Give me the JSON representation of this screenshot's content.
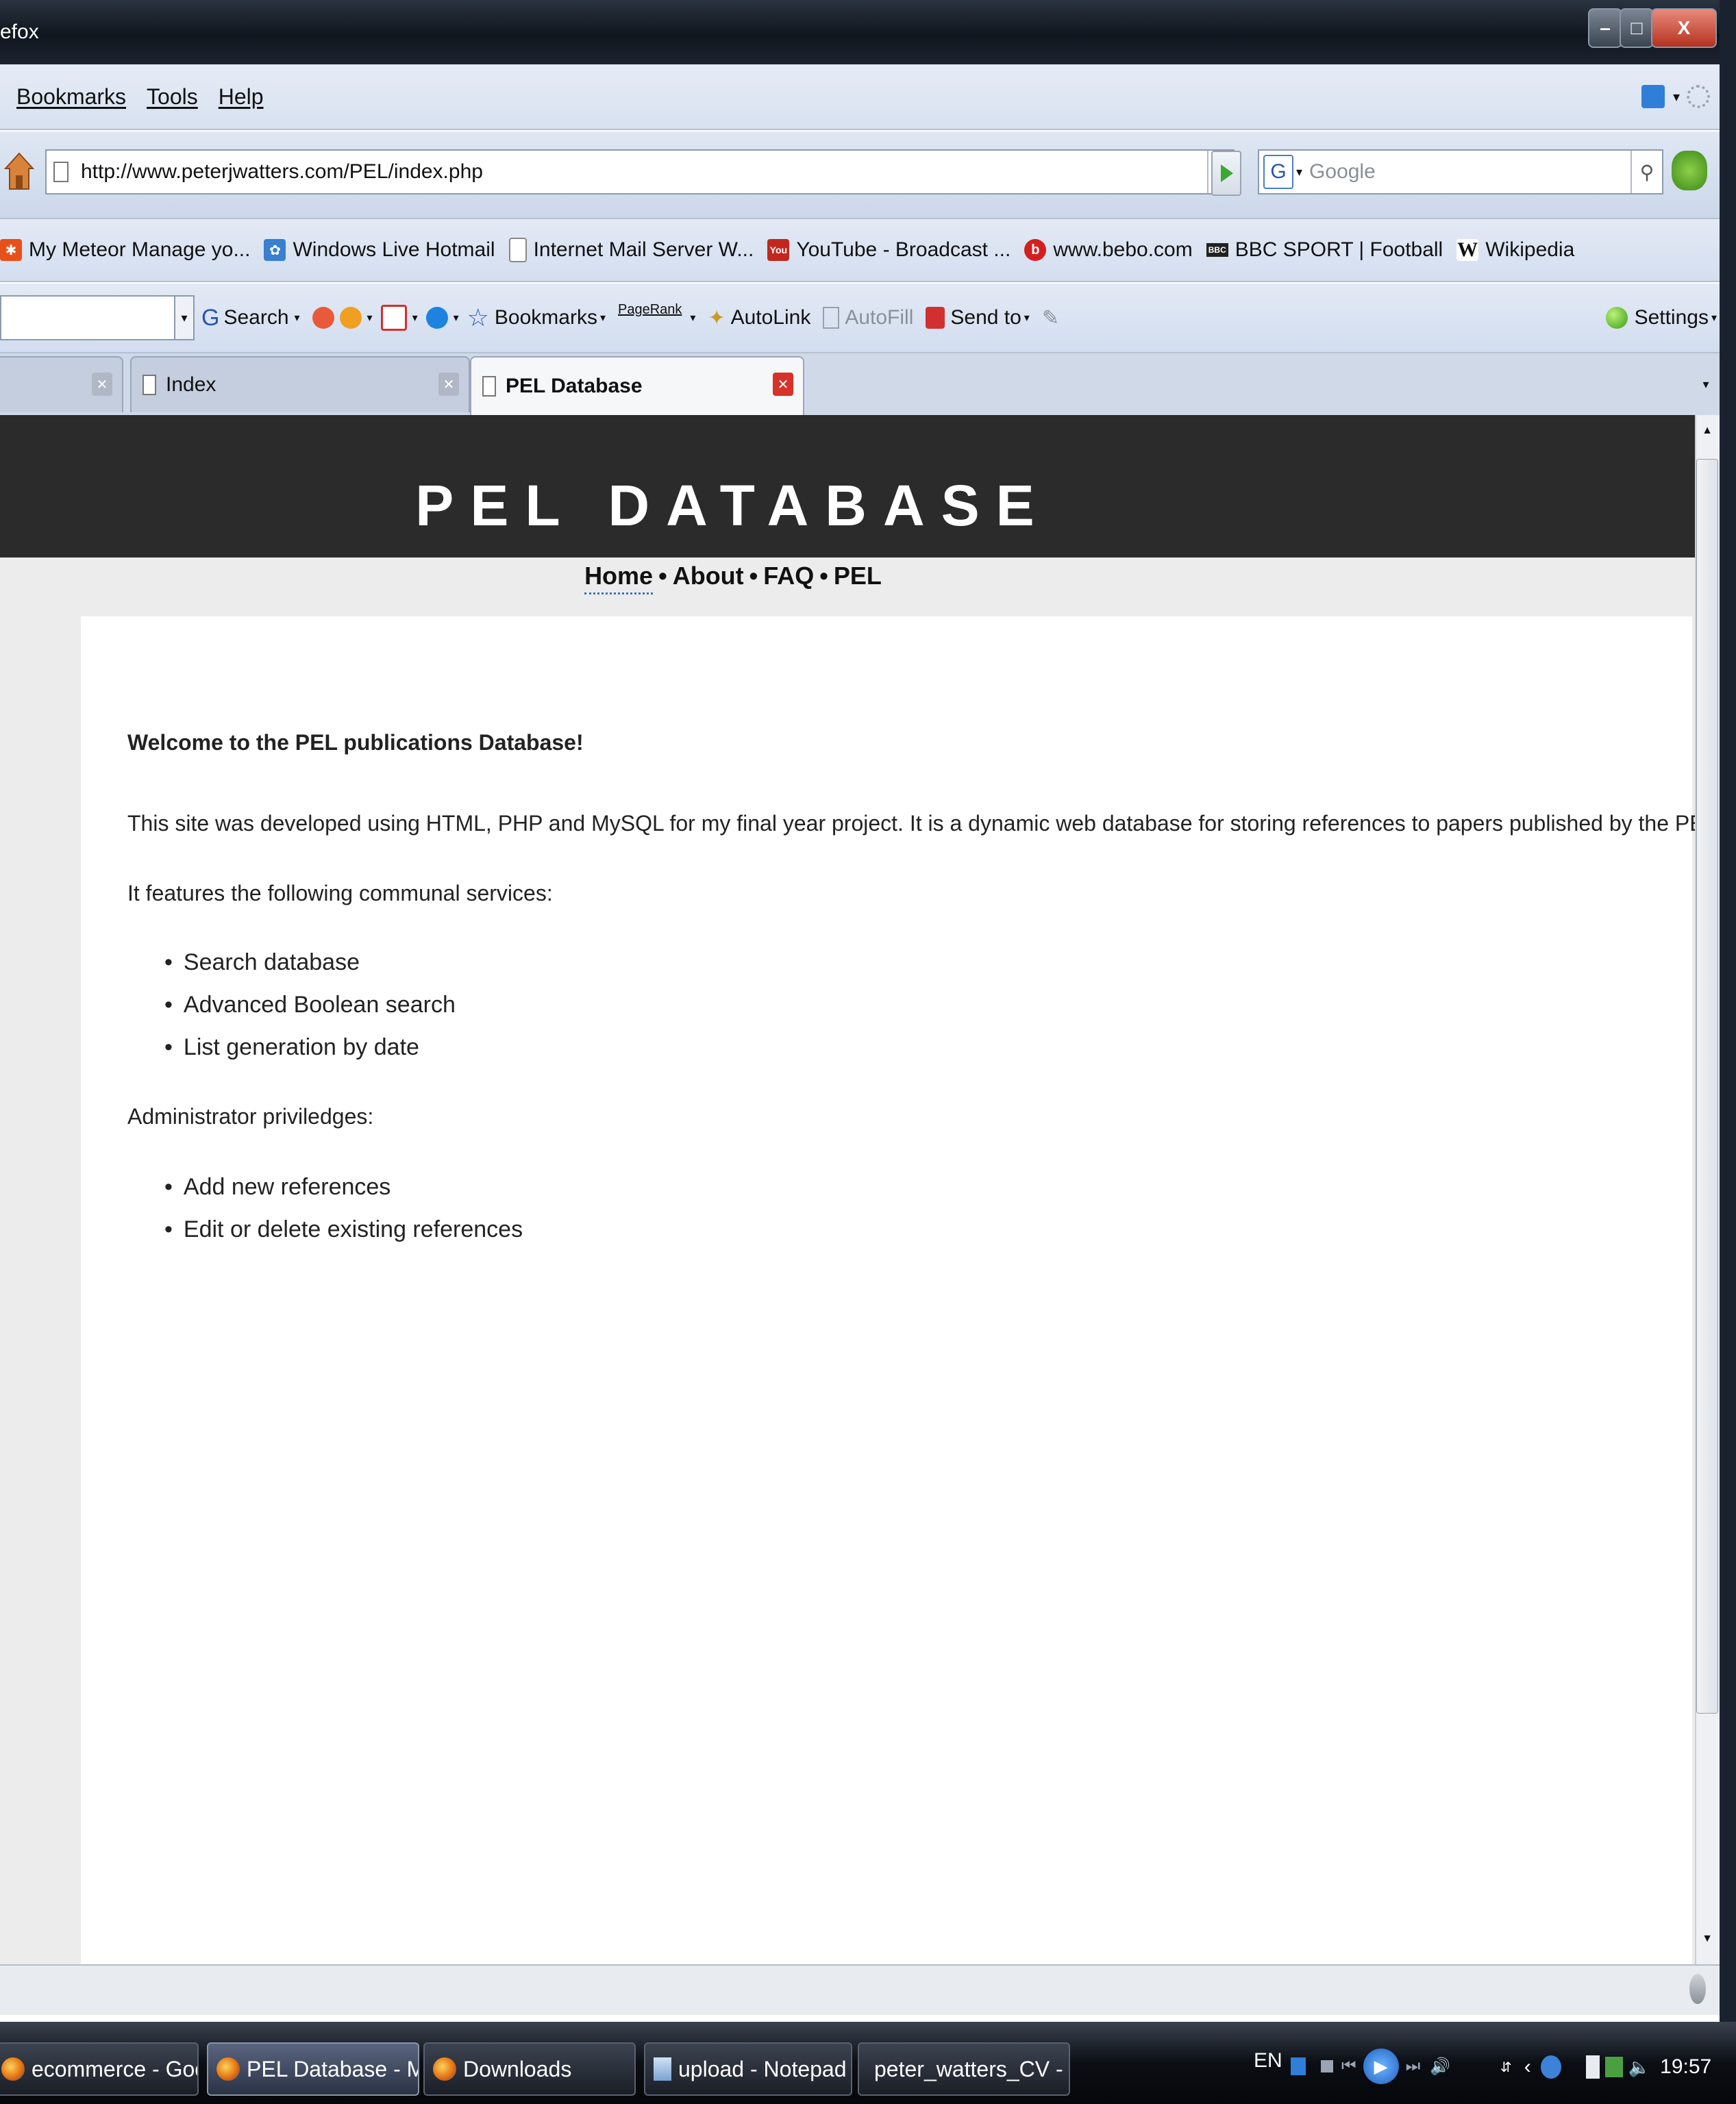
{
  "window": {
    "title": "efox"
  },
  "menu": {
    "items": [
      "Bookmarks",
      "Tools",
      "Help"
    ]
  },
  "nav": {
    "url": "http://www.peterjwatters.com/PEL/index.php",
    "search_placeholder": "Google"
  },
  "bookmarks": [
    {
      "label": "My Meteor Manage yo...",
      "icon": "meteor-icon",
      "color": "#e8501a"
    },
    {
      "label": "Windows Live Hotmail",
      "icon": "windows-live-icon",
      "color": "#3a7fd0"
    },
    {
      "label": "Internet Mail Server W...",
      "icon": "page-icon",
      "color": "#ffffff"
    },
    {
      "label": "YouTube - Broadcast ...",
      "icon": "youtube-icon",
      "color": "#c0281e"
    },
    {
      "label": "www.bebo.com",
      "icon": "bebo-icon",
      "color": "#d41f1f"
    },
    {
      "label": "BBC SPORT | Football",
      "icon": "bbc-icon",
      "color": "#222222"
    },
    {
      "label": "Wikipedia",
      "icon": "wikipedia-icon",
      "color": "#ffffff"
    }
  ],
  "google_toolbar": {
    "search": "Search",
    "bookmarks": "Bookmarks",
    "pagerank": "PageRank",
    "autolink": "AutoLink",
    "autofill": "AutoFill",
    "send_to": "Send to",
    "settings": "Settings"
  },
  "tabs": [
    {
      "label": "Index",
      "active": false
    },
    {
      "label": "PEL Database",
      "active": true
    }
  ],
  "page": {
    "title": "PEL DATABASE",
    "nav": [
      "Home",
      "About",
      "FAQ",
      "PEL"
    ],
    "nav_sep": "•",
    "welcome": "Welcome to the PEL publications Database!",
    "intro": "This site was developed using HTML, PHP and MySQL for my final year project. It is a dynamic web database for storing references to papers published by the PEL lab.",
    "features_heading": "It features the following communal services:",
    "features": [
      "Search database",
      "Advanced Boolean search",
      "List generation by date"
    ],
    "admin_heading": "Administrator priviledges:",
    "admin": [
      "Add new references",
      "Edit or delete existing references"
    ]
  },
  "taskbar": {
    "items": [
      "ecommerce - Googl...",
      "PEL Database - Mozi...",
      "Downloads",
      "upload - Notepad",
      "peter_watters_CV - ..."
    ],
    "lang": "EN",
    "clock": "19:57"
  }
}
